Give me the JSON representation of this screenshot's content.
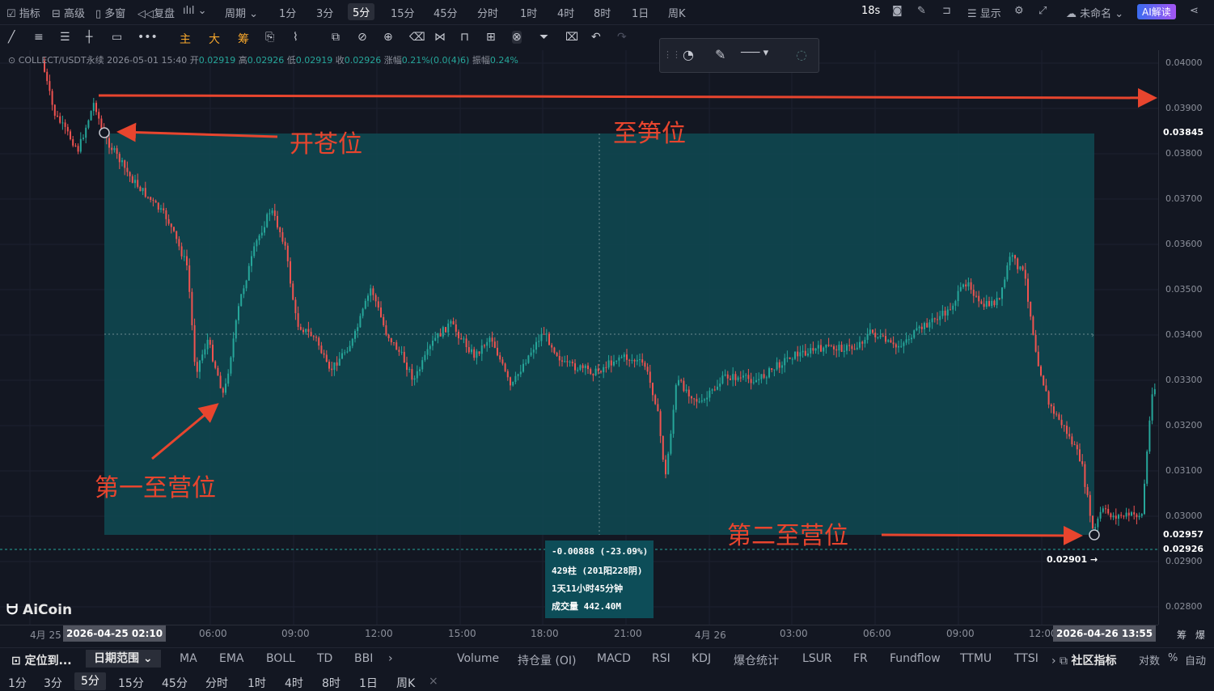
{
  "top_toolbar": {
    "items": [
      "指标",
      "高级",
      "多窗",
      "复盘",
      "周期",
      "1分",
      "3分",
      "5分",
      "15分",
      "45分",
      "分时",
      "1时",
      "4时",
      "8时",
      "1日",
      "周K"
    ],
    "active": "5分",
    "countdown": "18s",
    "display_label": "显示",
    "layout_name": "未命名",
    "ai_label": "AI解读"
  },
  "draw_toolbar": {
    "text_tools": [
      "主",
      "大",
      "筹"
    ]
  },
  "info_line": {
    "symbol": "COLLECT/USDT永续",
    "datetime": "2026-05-01 15:40",
    "open_label": "开",
    "open": "0.02919",
    "high_label": "高",
    "high": "0.02926",
    "low_label": "低",
    "low": "0.02919",
    "close_label": "收",
    "close": "0.02926",
    "change_label": "涨幅",
    "change": "0.21%(0.0(4)6)",
    "amp_label": "振幅",
    "amp": "0.24%"
  },
  "price_axis": {
    "labels": [
      "0.04000",
      "0.03900",
      "0.03800",
      "0.03700",
      "0.03600",
      "0.03500",
      "0.03400",
      "0.03300",
      "0.03200",
      "0.03100",
      "0.03000",
      "0.02900",
      "0.02800"
    ],
    "tag_top": "0.03845",
    "tag_mid": "0.02957",
    "tag_last": "0.02926",
    "low_marker": "0.02901",
    "tag_top_color": "#50535e",
    "tag_mid_color": "#50535e",
    "tag_last_color": "#26a69a"
  },
  "time_axis": {
    "labels": [
      "4月 25",
      "06:00",
      "09:00",
      "12:00",
      "15:00",
      "18:00",
      "21:00",
      "4月 26",
      "03:00",
      "06:00",
      "09:00",
      "12:00"
    ],
    "start_tag": "2026-04-25 02:10",
    "end_tag": "2026-04-26 13:55"
  },
  "annotations": {
    "open_pos": "开苍位",
    "bottom_top": "至笋位",
    "first_camp": "第一至营位",
    "second_camp": "第二至营位"
  },
  "measure": {
    "change": "-0.00888 (-23.09%)",
    "bars": "429柱 (201阳228阴)",
    "duration": "1天11小时45分钟",
    "volume": "成交量 442.40M"
  },
  "logo": "AiCoin",
  "indicator_bar": {
    "left": [
      "定位到...",
      "日期范围"
    ],
    "main": [
      "MA",
      "EMA",
      "BOLL",
      "TD",
      "BBI"
    ],
    "sub": [
      "Volume",
      "持仓量 (OI)",
      "MACD",
      "RSI",
      "KDJ",
      "爆仓统计",
      "LSUR",
      "FR",
      "Fundflow",
      "TTMU",
      "TTSI"
    ],
    "community": "社区指标",
    "right": [
      "对数",
      "%",
      "自动"
    ]
  },
  "period_bar": {
    "items": [
      "1分",
      "3分",
      "5分",
      "15分",
      "45分",
      "分时",
      "1时",
      "4时",
      "8时",
      "1日",
      "周K"
    ],
    "active": "5分"
  },
  "colors": {
    "up": "#26a69a",
    "down": "#ef5350",
    "zone": "#0f4a52",
    "annot": "#e8452e"
  }
}
